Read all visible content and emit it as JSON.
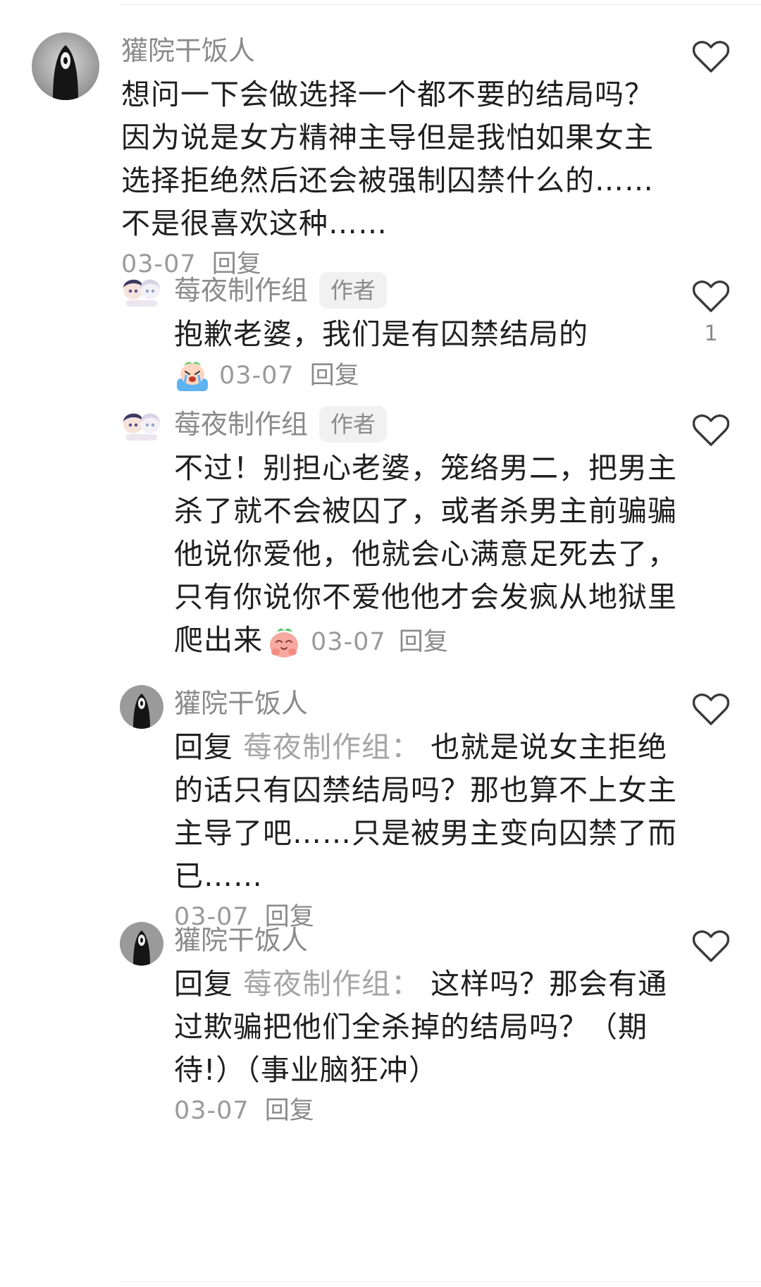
{
  "comments": [
    {
      "username": "獾院干饭人",
      "text": "想问一下会做选择一个都不要的结局吗？因为说是女方精神主导但是我怕如果女主选择拒绝然后还会被强制囚禁什么的……不是很喜欢这种……",
      "date": "03-07",
      "reply_label": "回复"
    },
    {
      "username": "莓夜制作组",
      "badge": "作者",
      "text": "抱歉老婆，我们是有囚禁结局的",
      "date": "03-07",
      "reply_label": "回复",
      "like_count": "1",
      "emoji": "crying-face-emoji"
    },
    {
      "username": "莓夜制作组",
      "badge": "作者",
      "text": "不过！别担心老婆，笼络男二，把男主杀了就不会被囚了，或者杀男主前骗骗他说你爱他，他就会心满意足死去了，只有你说你不爱他他才会发疯从地狱里爬出来",
      "date": "03-07",
      "reply_label": "回复",
      "emoji": "pleading-face-emoji"
    },
    {
      "username": "獾院干饭人",
      "reply_prefix": "回复",
      "reply_target": "莓夜制作组：",
      "text": "也就是说女主拒绝的话只有囚禁结局吗？那也算不上女主主导了吧……只是被男主变向囚禁了而已……",
      "date": "03-07",
      "reply_label": "回复"
    },
    {
      "username": "獾院干饭人",
      "reply_prefix": "回复",
      "reply_target": "莓夜制作组：",
      "text": "这样吗？那会有通过欺骗把他们全杀掉的结局吗？（期待!）（事业脑狂冲）",
      "date": "03-07",
      "reply_label": "回复"
    }
  ],
  "colors": {
    "username": "#8b8b8b",
    "text": "#1f1f1f",
    "meta": "#9a9a9a",
    "badge_bg": "#f1f1f1"
  }
}
